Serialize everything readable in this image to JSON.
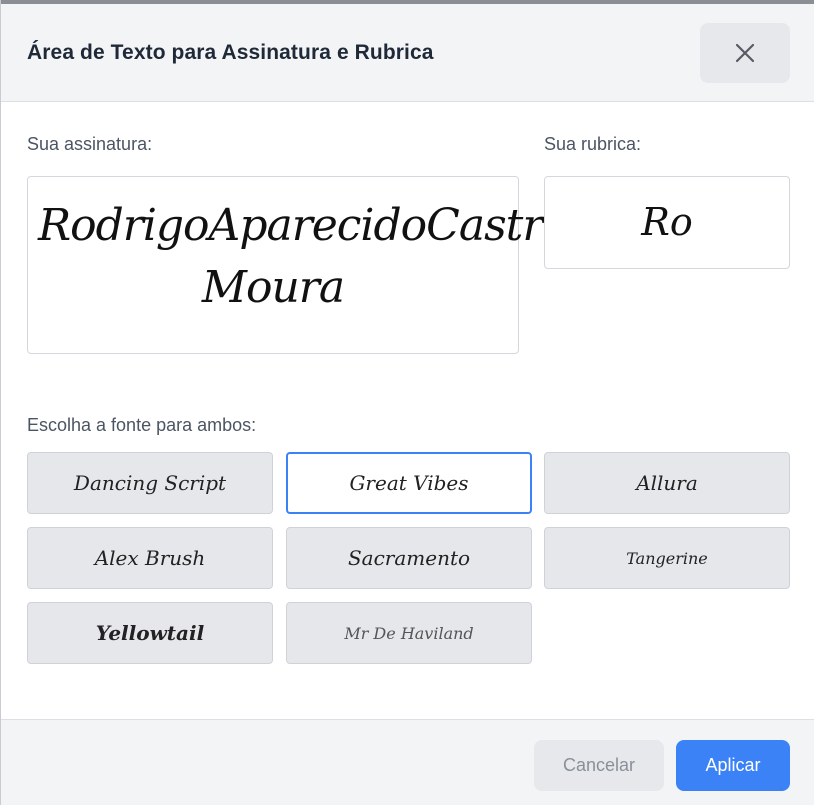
{
  "dialog": {
    "title": "Área de Texto para Assinatura e Rubrica",
    "close_icon": "close-icon"
  },
  "signature": {
    "label": "Sua assinatura:",
    "line1": "RodrigoAparecidoCastro",
    "line2": "Moura"
  },
  "initials": {
    "label": "Sua rubrica:",
    "value": "Ro"
  },
  "fonts": {
    "label": "Escolha a fonte para ambos:",
    "selected": "Great Vibes",
    "options": [
      {
        "name": "Dancing Script"
      },
      {
        "name": "Great Vibes"
      },
      {
        "name": "Allura"
      },
      {
        "name": "Alex Brush"
      },
      {
        "name": "Sacramento"
      },
      {
        "name": "Tangerine"
      },
      {
        "name": "Yellowtail"
      },
      {
        "name": "Mr De Haviland"
      }
    ]
  },
  "footer": {
    "cancel_label": "Cancelar",
    "apply_label": "Aplicar"
  },
  "colors": {
    "accent": "#3b82f6",
    "header_bg": "#f3f4f6",
    "option_bg": "#e5e7eb"
  }
}
